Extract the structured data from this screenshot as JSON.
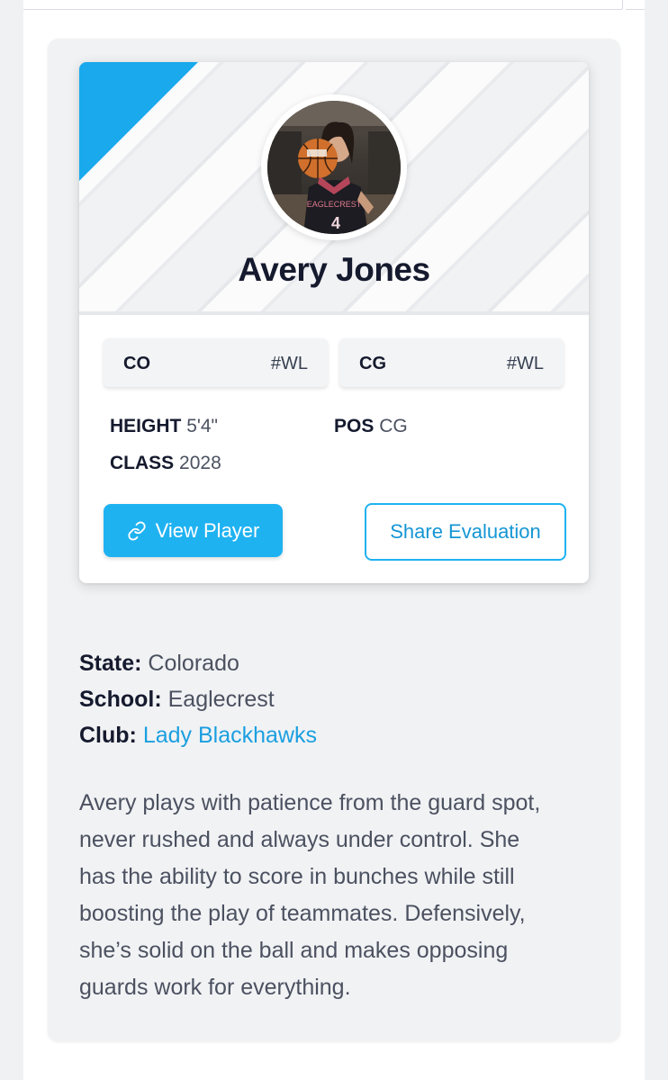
{
  "player": {
    "name": "Avery Jones",
    "jersey_number": "4",
    "state_rank": {
      "label": "CO",
      "value": "#WL"
    },
    "position_rank": {
      "label": "CG",
      "value": "#WL"
    },
    "height": {
      "label": "HEIGHT",
      "value": "5'4\""
    },
    "position": {
      "label": "POS",
      "value": "CG"
    },
    "class_year": {
      "label": "CLASS",
      "value": "2028"
    }
  },
  "actions": {
    "view_player": "View Player",
    "share_evaluation": "Share Evaluation"
  },
  "details": {
    "state": {
      "label": "State:",
      "value": "Colorado"
    },
    "school": {
      "label": "School:",
      "value": "Eaglecrest"
    },
    "club": {
      "label": "Club:",
      "value": "Lady Blackhawks"
    }
  },
  "bio": [
    "Avery plays with patience from the guard spot,",
    "never rushed and always under control. She",
    "has the ability to score in bunches while still",
    "boosting the play of teammates. Defensively,",
    "she’s solid on the ball and makes opposing",
    "guards work for everything."
  ],
  "colors": {
    "accent": "#1fb2f1",
    "link": "#1a9fe0",
    "heading": "#151a2e",
    "body_text": "#4b5160"
  },
  "icons": {
    "view_player": "link-icon"
  }
}
